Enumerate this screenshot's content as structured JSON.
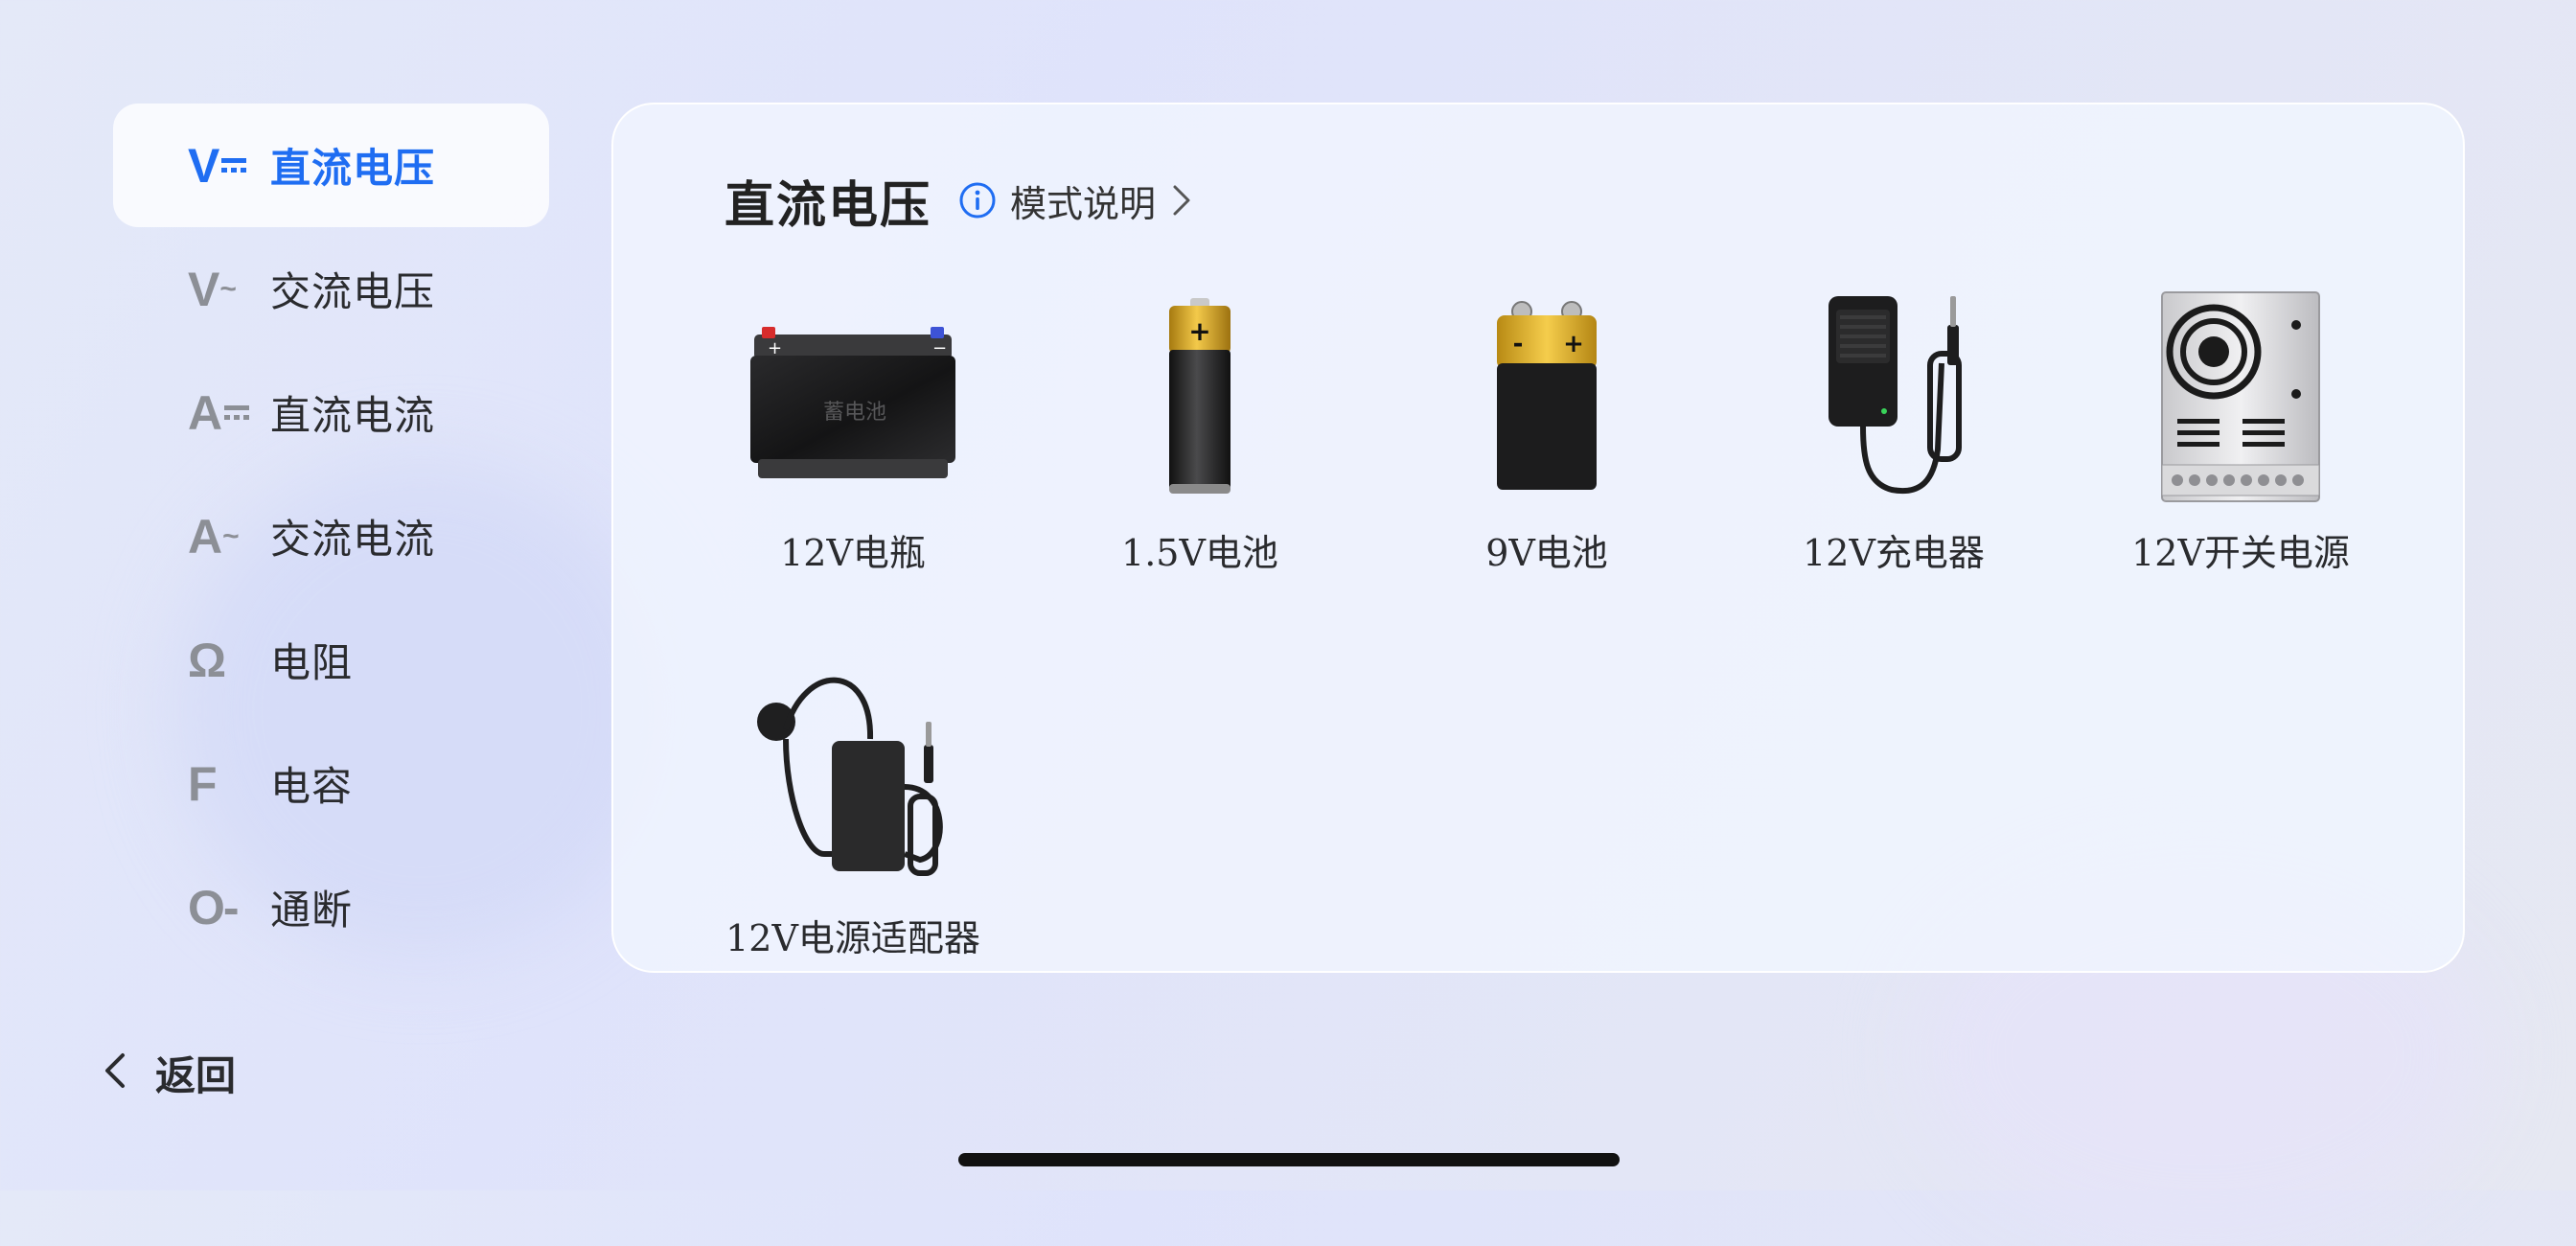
{
  "sidebar": {
    "items": [
      {
        "symbol": "V",
        "suffix_type": "dc",
        "label": "直流电压",
        "active": true
      },
      {
        "symbol": "V",
        "suffix": "~",
        "label": "交流电压",
        "active": false
      },
      {
        "symbol": "A",
        "suffix_type": "dc",
        "label": "直流电流",
        "active": false
      },
      {
        "symbol": "A",
        "suffix": "~",
        "label": "交流电流",
        "active": false
      },
      {
        "symbol": "Ω",
        "label": "电阻",
        "active": false
      },
      {
        "symbol": "F",
        "label": "电容",
        "active": false
      },
      {
        "symbol": "O-",
        "label": "通断",
        "active": false
      }
    ],
    "back_label": "返回"
  },
  "panel": {
    "title": "直流电压",
    "mode_link_label": "模式说明",
    "devices": [
      {
        "label": "12V电瓶",
        "icon": "car-battery-icon",
        "watermark": "蓄电池"
      },
      {
        "label": "1.5V电池",
        "icon": "aa-battery-icon",
        "marks": [
          "+"
        ]
      },
      {
        "label": "9V电池",
        "icon": "9v-battery-icon",
        "marks": [
          "-",
          "+"
        ]
      },
      {
        "label": "12V充电器",
        "icon": "wall-charger-icon"
      },
      {
        "label": "12V开关电源",
        "icon": "switching-power-supply-icon"
      },
      {
        "label": "12V电源适配器",
        "icon": "power-adapter-icon"
      }
    ]
  },
  "colors": {
    "accent": "#1f6df2",
    "inactive_symbol": "#8c8f96",
    "battery_gold": "#e3b128"
  }
}
